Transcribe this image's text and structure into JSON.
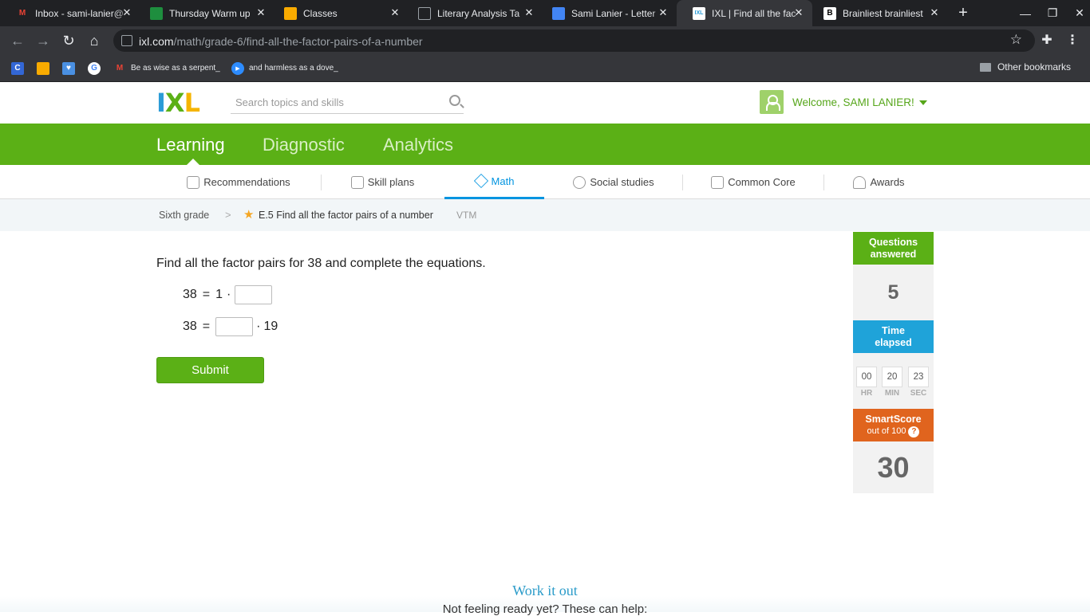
{
  "browser": {
    "tabs": [
      {
        "title": "Inbox - sami-lanier@",
        "favicon": "gmail-icon",
        "color": "#ea4335",
        "active": false
      },
      {
        "title": "Thursday Warm up",
        "favicon": "classroom-icon",
        "color": "#1e8e3e",
        "active": false
      },
      {
        "title": "Classes",
        "favicon": "classroom-icon",
        "color": "#f9ab00",
        "active": false
      },
      {
        "title": "Literary Analysis Ta",
        "favicon": "doc-icon",
        "color": "#9aa0a6",
        "active": false
      },
      {
        "title": "Sami Lanier - Letter",
        "favicon": "docs-icon",
        "color": "#4285f4",
        "active": false
      },
      {
        "title": "IXL | Find all the fac",
        "favicon": "ixl-icon",
        "color": "#f9ab00",
        "active": true
      },
      {
        "title": "Brainliest brainliest",
        "favicon": "brainly-icon",
        "color": "#000000",
        "active": false
      }
    ],
    "url_host": "ixl.com",
    "url_path": "/math/grade-6/find-all-the-factor-pairs-of-a-number",
    "bookmarks": [
      {
        "label": "",
        "icon": "c-icon",
        "color": "#3367d6",
        "glyph": "C"
      },
      {
        "label": "",
        "icon": "classroom-icon",
        "color": "#f9ab00",
        "glyph": ""
      },
      {
        "label": "",
        "icon": "shield-icon",
        "color": "#4a90e2",
        "glyph": "♥"
      },
      {
        "label": "",
        "icon": "google-icon",
        "color": "#ffffff",
        "glyph": "G"
      },
      {
        "label": "Be as wise as a serpent_",
        "icon": "gmail-icon",
        "color": "#ea4335",
        "glyph": "M"
      },
      {
        "label": "and harmless as a dove_",
        "icon": "video-icon",
        "color": "#2d8cff",
        "glyph": "▶"
      }
    ],
    "other_bookmarks": "Other bookmarks"
  },
  "header": {
    "search_placeholder": "Search topics and skills",
    "welcome": "Welcome, SAMI LANIER!",
    "logo_letters": [
      "I",
      "X",
      "L"
    ],
    "logo_colors": [
      "#2a9bd6",
      "#5bb016",
      "#f5b400"
    ]
  },
  "main_nav": [
    "Learning",
    "Diagnostic",
    "Analytics"
  ],
  "sub_nav": [
    {
      "label": "Recommendations",
      "icon": "recommendations-icon",
      "active": false
    },
    {
      "label": "Skill plans",
      "icon": "skill-plans-icon",
      "active": false
    },
    {
      "label": "Math",
      "icon": "math-icon",
      "active": true
    },
    {
      "label": "Social studies",
      "icon": "globe-icon",
      "active": false
    },
    {
      "label": "Common Core",
      "icon": "common-core-icon",
      "active": false
    },
    {
      "label": "Awards",
      "icon": "awards-icon",
      "active": false
    }
  ],
  "breadcrumb": {
    "grade": "Sixth grade",
    "separator": ">",
    "skill": "E.5 Find all the factor pairs of a number",
    "code": "VTM"
  },
  "question": {
    "prompt": "Find all the factor pairs for 38 and complete the equations.",
    "eq1": {
      "lhs": "38",
      "equals": "=",
      "factor": "1",
      "dot": "·",
      "answer": ""
    },
    "eq2": {
      "lhs": "38",
      "equals": "=",
      "answer": "",
      "dot": "·",
      "factor": "19"
    },
    "submit": "Submit"
  },
  "stats": {
    "questions_label": "Questions answered",
    "questions_value": "5",
    "time_label": "Time elapsed",
    "time": [
      {
        "value": "00",
        "unit": "HR"
      },
      {
        "value": "20",
        "unit": "MIN"
      },
      {
        "value": "23",
        "unit": "SEC"
      }
    ],
    "smartscore_label": "SmartScore",
    "smartscore_sub": "out of 100",
    "smartscore_value": "30",
    "colors": {
      "questions": "#5bb016",
      "time": "#1fa3d9",
      "smartscore": "#e0641e"
    }
  },
  "work_it_out": {
    "title": "Work it out",
    "subtitle": "Not feeling ready yet? These can help:"
  }
}
